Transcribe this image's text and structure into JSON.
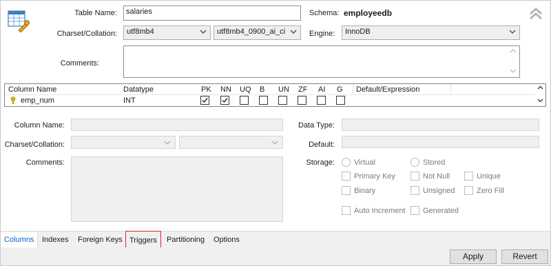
{
  "table": {
    "name_label": "Table Name:",
    "name_value": "salaries",
    "schema_label": "Schema:",
    "schema_value": "employeedb",
    "charset_label": "Charset/Collation:",
    "charset_value": "utf8mb4",
    "collation_value": "utf8mb4_0900_ai_ci",
    "engine_label": "Engine:",
    "engine_value": "InnoDB",
    "comments_label": "Comments:",
    "comments_value": ""
  },
  "grid": {
    "headers": [
      "Column Name",
      "Datatype",
      "PK",
      "NN",
      "UQ",
      "B",
      "UN",
      "ZF",
      "AI",
      "G",
      "Default/Expression"
    ],
    "rows": [
      {
        "name": "emp_num",
        "datatype": "INT",
        "pk": true,
        "nn": true,
        "uq": false,
        "b": false,
        "un": false,
        "zf": false,
        "ai": false,
        "g": false,
        "default": ""
      }
    ]
  },
  "column_detail": {
    "column_name_label": "Column Name:",
    "charset_label": "Charset/Collation:",
    "comments_label": "Comments:",
    "datatype_label": "Data Type:",
    "default_label": "Default:",
    "storage_label": "Storage:",
    "virtual_label": "Virtual",
    "stored_label": "Stored",
    "primary_key_label": "Primary Key",
    "not_null_label": "Not Null",
    "unique_label": "Unique",
    "binary_label": "Binary",
    "unsigned_label": "Unsigned",
    "zero_fill_label": "Zero Fill",
    "auto_increment_label": "Auto Increment",
    "generated_label": "Generated"
  },
  "tabs": [
    "Columns",
    "Indexes",
    "Foreign Keys",
    "Triggers",
    "Partitioning",
    "Options"
  ],
  "active_tab": "Columns",
  "highlighted_tab": "Triggers",
  "buttons": {
    "apply": "Apply",
    "revert": "Revert"
  },
  "colors": {
    "accent": "#0066cc",
    "highlight_border": "#d9262c",
    "key_icon": "#e0b400"
  },
  "icons": [
    "table-settings-icon",
    "collapse-up-icon",
    "primary-key-icon",
    "chevron-down-icon",
    "check-icon"
  ]
}
